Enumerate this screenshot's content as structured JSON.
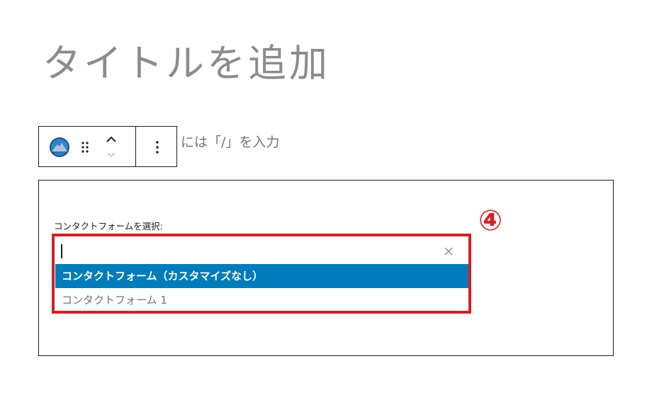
{
  "editor": {
    "title_placeholder": "タイトルを追加",
    "block_hint_partial": "には「/」を入力"
  },
  "toolbar": {
    "block_icon": "mountain-logo-icon",
    "drag_icon": "drag-handle-icon",
    "move_up_icon": "chevron-up-icon",
    "move_down_icon": "chevron-down-icon",
    "more_icon": "more-vertical-icon"
  },
  "contact_block": {
    "select_label": "コンタクトフォームを選択:",
    "search_value": "",
    "clear_icon": "close-icon",
    "options": [
      {
        "label": "コンタクトフォーム（カスタマイズなし）",
        "selected": true
      },
      {
        "label": "コンタクトフォーム 1",
        "selected": false
      }
    ]
  },
  "annotation": {
    "step_number": "④",
    "highlight_color": "#d12125"
  },
  "colors": {
    "accent": "#007cba",
    "text": "#1e1e1e",
    "muted": "#757575"
  }
}
